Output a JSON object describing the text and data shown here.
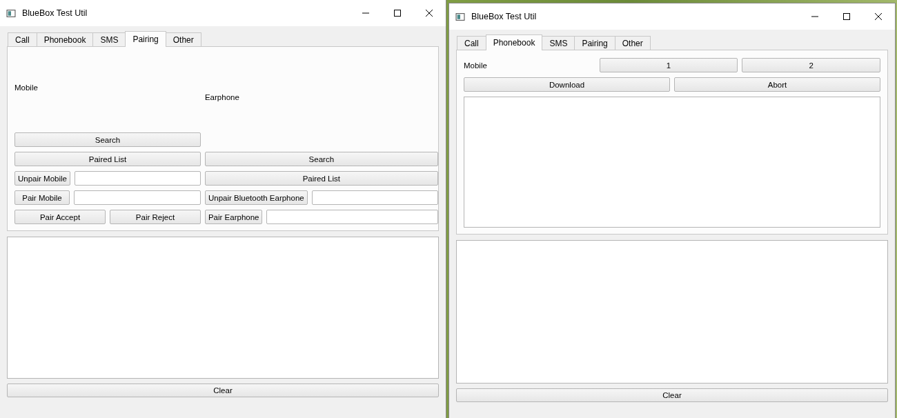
{
  "windows": [
    {
      "title": "BlueBox Test Util",
      "tabs": [
        {
          "label": "Call",
          "selected": false
        },
        {
          "label": "Phonebook",
          "selected": false
        },
        {
          "label": "SMS",
          "selected": false
        },
        {
          "label": "Pairing",
          "selected": true
        },
        {
          "label": "Other",
          "selected": false
        }
      ],
      "panel": {
        "kind": "pairing",
        "columns": [
          {
            "label": "Mobile",
            "rows": [
              {
                "items": [
                  {
                    "kind": "button",
                    "label": "Search"
                  }
                ]
              },
              {
                "items": [
                  {
                    "kind": "button",
                    "label": "Paired List"
                  }
                ]
              },
              {
                "items": [
                  {
                    "kind": "button",
                    "label": "Unpair Mobile"
                  },
                  {
                    "kind": "field"
                  }
                ]
              },
              {
                "items": [
                  {
                    "kind": "button",
                    "label": "Pair Mobile"
                  },
                  {
                    "kind": "field"
                  }
                ]
              },
              {
                "items": [
                  {
                    "kind": "button",
                    "label": "Pair Accept"
                  },
                  {
                    "kind": "button",
                    "label": "Pair Reject"
                  }
                ]
              }
            ]
          },
          {
            "label": "Earphone",
            "rows": [
              {
                "items": [
                  {
                    "kind": "button",
                    "label": "Search"
                  }
                ]
              },
              {
                "items": [
                  {
                    "kind": "button",
                    "label": "Paired List"
                  }
                ]
              },
              {
                "items": [
                  {
                    "kind": "button",
                    "label": "Unpair Bluetooth Earphone"
                  },
                  {
                    "kind": "field"
                  }
                ]
              },
              {
                "items": [
                  {
                    "kind": "button",
                    "label": "Pair Earphone"
                  },
                  {
                    "kind": "field"
                  }
                ]
              }
            ]
          }
        ]
      },
      "clear_button": "Clear"
    },
    {
      "title": "BlueBox Test Util",
      "tabs": [
        {
          "label": "Call",
          "selected": false
        },
        {
          "label": "Phonebook",
          "selected": true
        },
        {
          "label": "SMS",
          "selected": false
        },
        {
          "label": "Pairing",
          "selected": false
        },
        {
          "label": "Other",
          "selected": false
        }
      ],
      "panel": {
        "kind": "phonebook",
        "rows": [
          {
            "items": [
              {
                "kind": "label",
                "label": "Mobile"
              },
              {
                "kind": "button",
                "label": "1"
              },
              {
                "kind": "button",
                "label": "2"
              }
            ]
          },
          {
            "items": [
              {
                "kind": "button",
                "label": "Download"
              },
              {
                "kind": "button",
                "label": "Abort"
              }
            ]
          }
        ]
      },
      "clear_button": "Clear"
    }
  ]
}
